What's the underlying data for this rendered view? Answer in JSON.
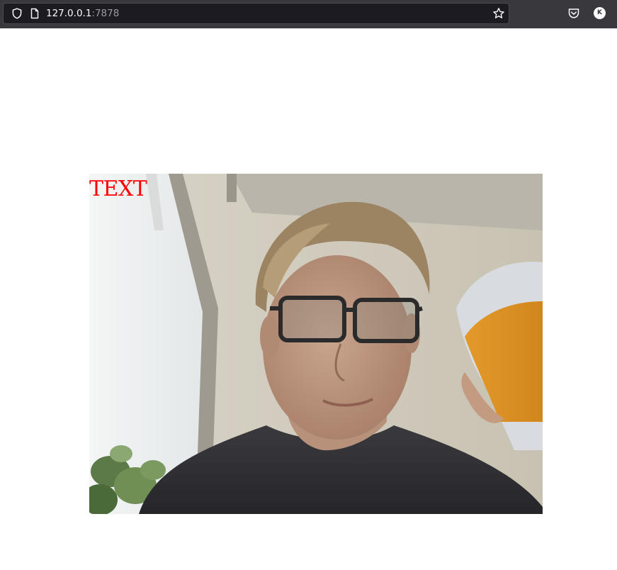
{
  "browser": {
    "url_host": "127.0.0.1",
    "url_port": ":7878",
    "icons": {
      "site_security": "shield-icon",
      "page": "page-icon",
      "bookmark": "star-icon",
      "pocket": "pocket-icon"
    },
    "account_initial": "K"
  },
  "page": {
    "overlay_text": "TEXT",
    "overlay_color": "#ff0000",
    "media": "webcam-image"
  }
}
